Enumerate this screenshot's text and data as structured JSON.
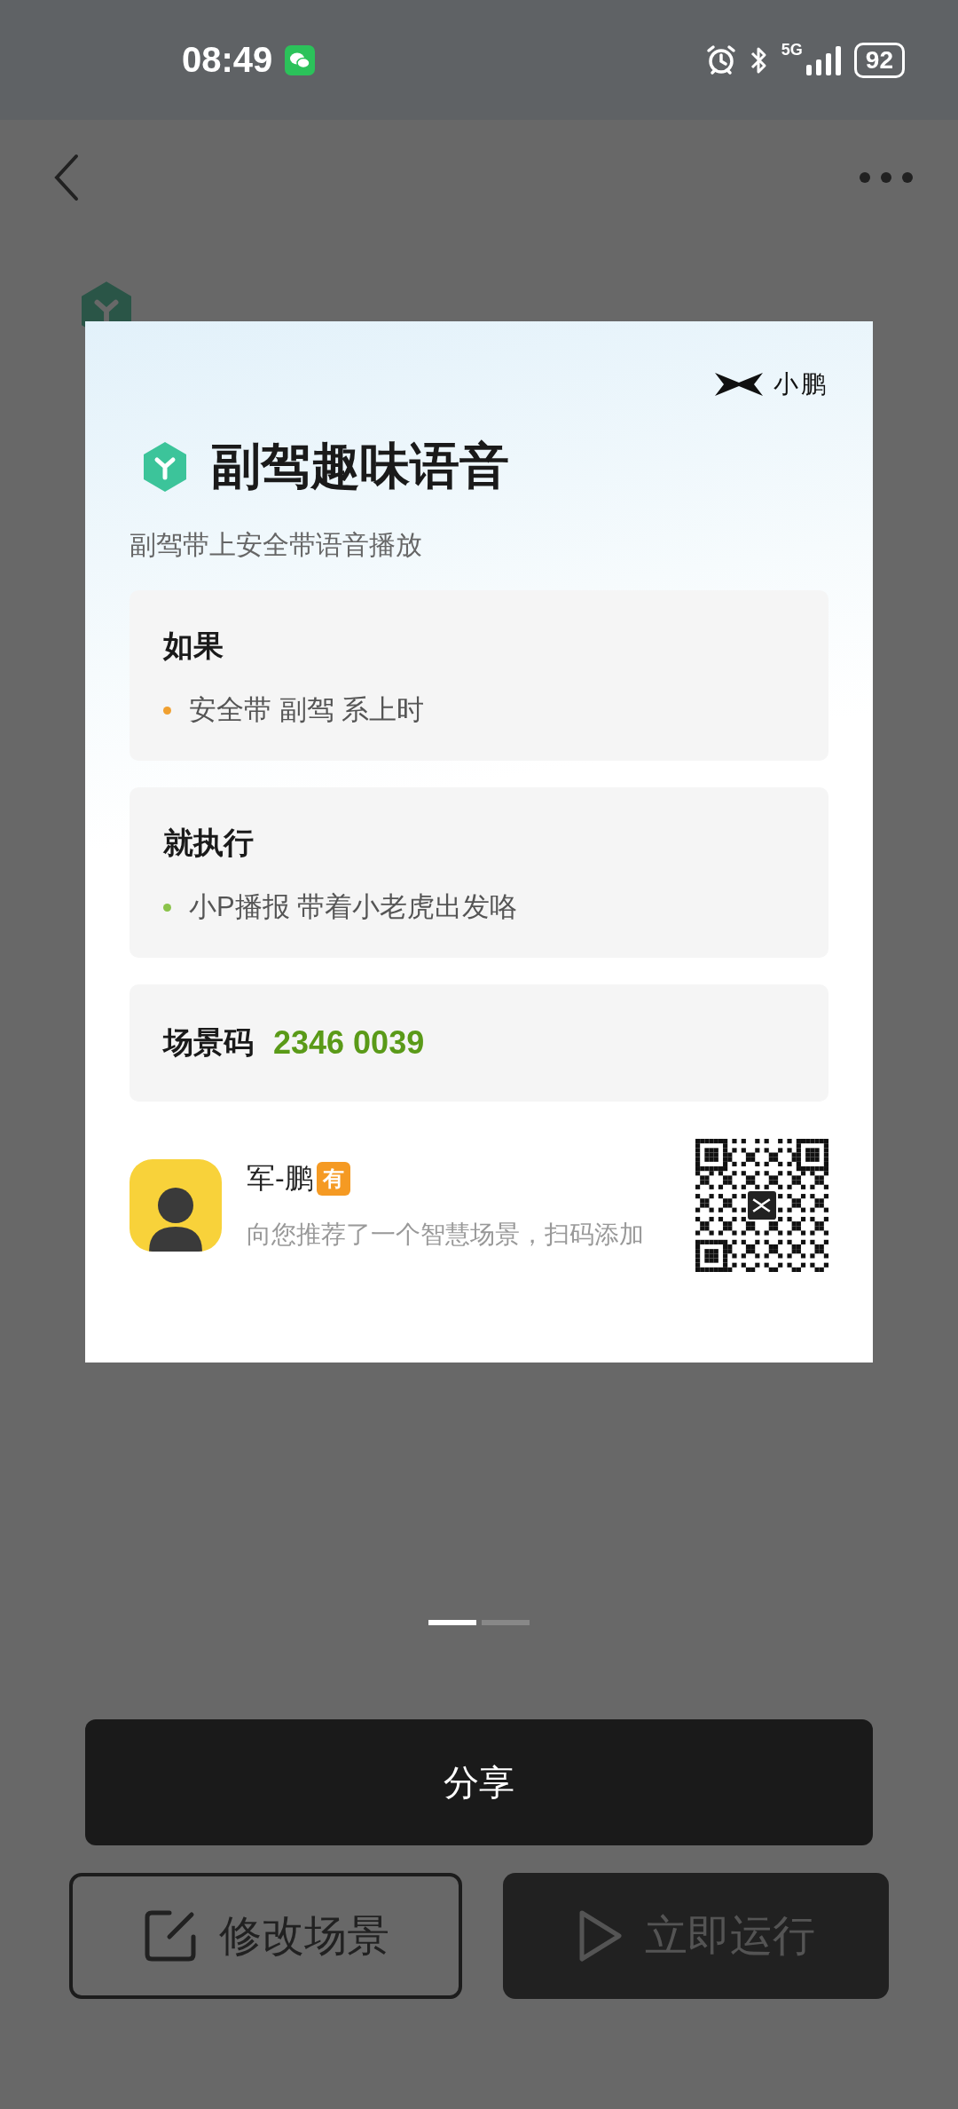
{
  "status_bar": {
    "time": "08:49",
    "network": "5G",
    "battery": "92"
  },
  "card": {
    "brand": "小鹏",
    "title": "副驾趣味语音",
    "subtitle": "副驾带上安全带语音播放",
    "sections": [
      {
        "heading": "如果",
        "items": [
          {
            "text": "安全带 副驾 系上时",
            "color": "#f0a030"
          }
        ]
      },
      {
        "heading": "就执行",
        "items": [
          {
            "text": "小P播报 带着小老虎出发咯",
            "color": "#8bc34a"
          }
        ]
      }
    ],
    "code": {
      "label": "场景码",
      "value": "2346 0039"
    },
    "sharer": {
      "name": "军-鹏",
      "badge": "有",
      "message": "向您推荐了一个智慧场景，扫码添加"
    }
  },
  "pager": [
    {
      "selected": true
    },
    {
      "selected": false
    }
  ],
  "share_button": "分享",
  "actions": [
    {
      "kind": "outline",
      "label": "修改场景"
    },
    {
      "kind": "filled",
      "label": "立即运行"
    }
  ]
}
